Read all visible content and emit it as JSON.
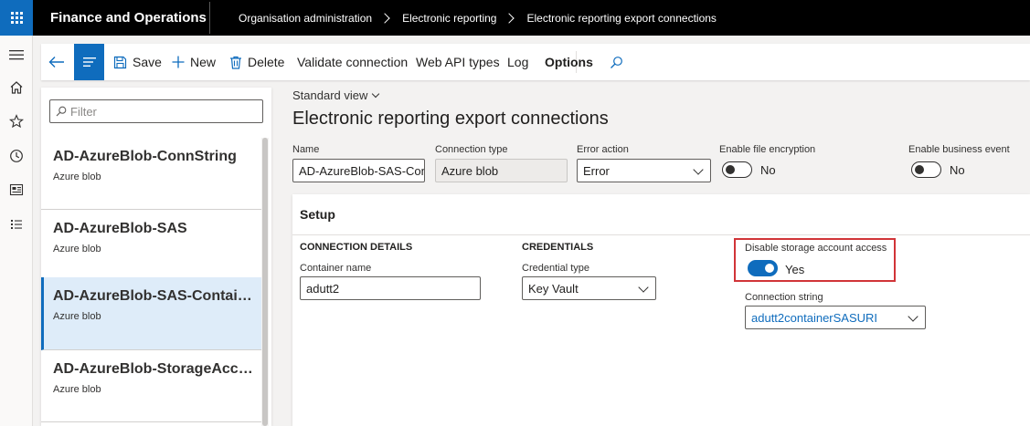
{
  "topbar": {
    "app_title": "Finance and Operations",
    "breadcrumb": [
      "Organisation administration",
      "Electronic reporting",
      "Electronic reporting export connections"
    ]
  },
  "rail": {
    "icons": [
      "hamburger-icon",
      "home-icon",
      "star-icon",
      "clock-icon",
      "workspace-icon",
      "list-icon"
    ]
  },
  "toolbar": {
    "save_label": "Save",
    "new_label": "New",
    "delete_label": "Delete",
    "validate_label": "Validate connection",
    "webapi_label": "Web API types",
    "log_label": "Log",
    "options_label": "Options"
  },
  "list": {
    "filter_placeholder": "Filter",
    "items": [
      {
        "title": "AD-AzureBlob-ConnString",
        "sub": "Azure blob",
        "selected": false
      },
      {
        "title": "AD-AzureBlob-SAS",
        "sub": "Azure blob",
        "selected": false
      },
      {
        "title": "AD-AzureBlob-SAS-Container",
        "sub": "Azure blob",
        "selected": true
      },
      {
        "title": "AD-AzureBlob-StorageAccount",
        "sub": "Azure blob",
        "selected": false
      }
    ]
  },
  "main": {
    "view_label": "Standard view",
    "page_title": "Electronic reporting export connections",
    "name_label": "Name",
    "name_value": "AD-AzureBlob-SAS-Container",
    "conn_type_label": "Connection type",
    "conn_type_value": "Azure blob",
    "error_action_label": "Error action",
    "error_action_value": "Error",
    "file_enc_label": "Enable file encryption",
    "file_enc_value": "No",
    "business_event_label": "Enable business event",
    "business_event_value": "No"
  },
  "setup": {
    "title": "Setup",
    "conn_details_title": "CONNECTION DETAILS",
    "container_label": "Container name",
    "container_value": "adutt2",
    "credentials_title": "CREDENTIALS",
    "cred_type_label": "Credential type",
    "cred_type_value": "Key Vault",
    "disable_access_label": "Disable storage account access",
    "disable_access_value": "Yes",
    "conn_string_label": "Connection string",
    "conn_string_value": "adutt2containerSASURI"
  },
  "colors": {
    "accent": "#0f6cbd",
    "highlight": "#d13438",
    "selected_bg": "#deecf9"
  }
}
